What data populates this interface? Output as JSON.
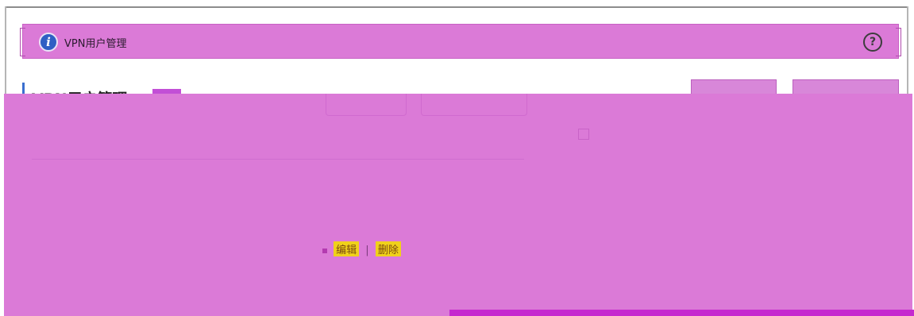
{
  "header": {
    "title": "VPN用户管理",
    "info_icon_glyph": "i",
    "help_icon_glyph": "?"
  },
  "section": {
    "title": "VPN用户管理"
  },
  "toolbar": {
    "add_label": "",
    "import_label": ""
  },
  "list": {
    "hint_text": "",
    "row": {
      "edit_label": "编辑",
      "separator": "|",
      "delete_label": "删除"
    }
  },
  "colors": {
    "overlay": "#db7ad7",
    "accent": "#3a6fcf",
    "highlight": "#f0d11a",
    "bottom_bar": "#c529cf"
  },
  "icons": [
    "info-icon",
    "help-icon"
  ]
}
